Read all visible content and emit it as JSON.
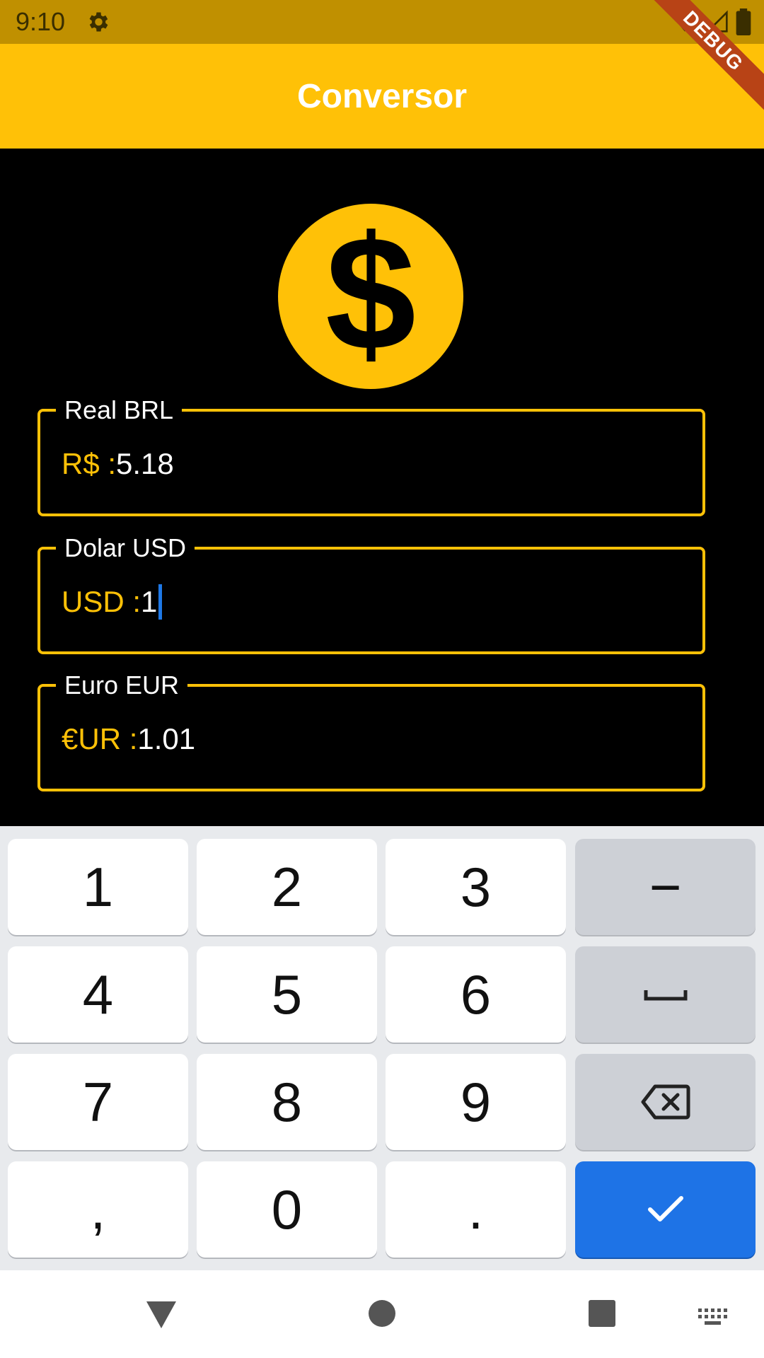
{
  "status_bar": {
    "time": "9:10",
    "debug_label": "DEBUG"
  },
  "app_bar": {
    "title": "Conversor"
  },
  "coin": {
    "symbol": "$"
  },
  "fields": [
    {
      "label": "Real BRL",
      "prefix": "R$ : ",
      "value": "5.18"
    },
    {
      "label": "Dolar USD",
      "prefix": "USD :",
      "value": "1"
    },
    {
      "label": "Euro EUR",
      "prefix": "€UR : ",
      "value": "1.01"
    }
  ],
  "keyboard": {
    "keys": [
      "1",
      "2",
      "3",
      "−",
      "4",
      "5",
      "6",
      "␣",
      "7",
      "8",
      "9",
      "⌫",
      ",",
      "0",
      ".",
      "✓"
    ]
  },
  "colors": {
    "accent": "#FFC107",
    "status": "#C09000",
    "enter": "#1E73E6"
  }
}
